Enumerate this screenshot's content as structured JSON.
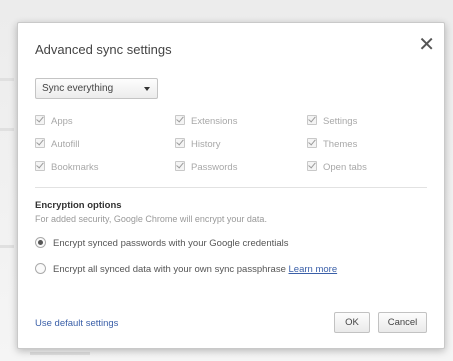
{
  "dialog": {
    "title": "Advanced sync settings",
    "close_symbol": "✕",
    "sync_select": {
      "value": "Sync everything"
    },
    "data_types": [
      {
        "label": "Apps",
        "checked": true
      },
      {
        "label": "Extensions",
        "checked": true
      },
      {
        "label": "Settings",
        "checked": true
      },
      {
        "label": "Autofill",
        "checked": true
      },
      {
        "label": "History",
        "checked": true
      },
      {
        "label": "Themes",
        "checked": true
      },
      {
        "label": "Bookmarks",
        "checked": true
      },
      {
        "label": "Passwords",
        "checked": true
      },
      {
        "label": "Open tabs",
        "checked": true
      }
    ],
    "encryption": {
      "title": "Encryption options",
      "description": "For added security, Google Chrome will encrypt your data.",
      "option1": "Encrypt synced passwords with your Google credentials",
      "option2": "Encrypt all synced data with your own sync passphrase",
      "learn_more": "Learn more",
      "selected": 1
    },
    "footer": {
      "default_link": "Use default settings",
      "ok": "OK",
      "cancel": "Cancel"
    }
  }
}
